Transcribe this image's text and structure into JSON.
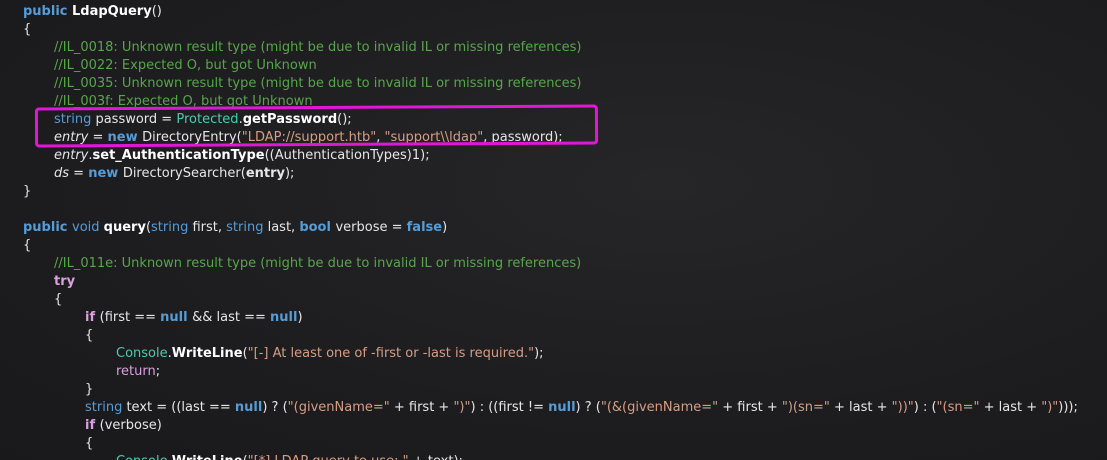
{
  "lines": [
    [
      {
        "t": "public ",
        "c": "kwb"
      },
      {
        "t": "LdapQuery",
        "c": "fn"
      },
      {
        "t": "()",
        "c": "pl"
      }
    ],
    [
      {
        "t": "{",
        "c": "pl"
      }
    ],
    [
      {
        "t": "//IL_0018: Unknown result type (might be due to invalid IL or missing references)",
        "c": "cm"
      }
    ],
    [
      {
        "t": "//IL_0022: Expected O, but got Unknown",
        "c": "cm"
      }
    ],
    [
      {
        "t": "//IL_0035: Unknown result type (might be due to invalid IL or missing references)",
        "c": "cm"
      }
    ],
    [
      {
        "t": "//IL_003f: Expected O, but got Unknown",
        "c": "cm"
      }
    ],
    [
      {
        "t": "string ",
        "c": "kw"
      },
      {
        "t": "password = ",
        "c": "pl"
      },
      {
        "t": "Protected",
        "c": "ty"
      },
      {
        "t": ".",
        "c": "pl"
      },
      {
        "t": "getPassword",
        "c": "fn"
      },
      {
        "t": "();",
        "c": "pl"
      }
    ],
    [
      {
        "t": "entry",
        "c": "var"
      },
      {
        "t": " = ",
        "c": "pl"
      },
      {
        "t": "new ",
        "c": "kwb"
      },
      {
        "t": "DirectoryEntry(",
        "c": "pl"
      },
      {
        "t": "\"LDAP://support.htb\"",
        "c": "str"
      },
      {
        "t": ", ",
        "c": "pl"
      },
      {
        "t": "\"support\\\\ldap\"",
        "c": "str"
      },
      {
        "t": ", password);",
        "c": "pl"
      }
    ],
    [
      {
        "t": "entry",
        "c": "var"
      },
      {
        "t": ".",
        "c": "pl"
      },
      {
        "t": "set_AuthenticationType",
        "c": "fn"
      },
      {
        "t": "((AuthenticationTypes)1);",
        "c": "pl"
      }
    ],
    [
      {
        "t": "ds",
        "c": "var"
      },
      {
        "t": " = ",
        "c": "pl"
      },
      {
        "t": "new ",
        "c": "kwb"
      },
      {
        "t": "DirectorySearcher(",
        "c": "pl"
      },
      {
        "t": "entry",
        "c": "bold"
      },
      {
        "t": ");",
        "c": "pl"
      }
    ],
    [
      {
        "t": "}",
        "c": "pl"
      }
    ],
    [],
    [
      {
        "t": "public ",
        "c": "kwb"
      },
      {
        "t": "void ",
        "c": "kw"
      },
      {
        "t": "query",
        "c": "fn"
      },
      {
        "t": "(",
        "c": "pl"
      },
      {
        "t": "string ",
        "c": "kw"
      },
      {
        "t": "first, ",
        "c": "pl"
      },
      {
        "t": "string ",
        "c": "kw"
      },
      {
        "t": "last, ",
        "c": "pl"
      },
      {
        "t": "bool ",
        "c": "kwb"
      },
      {
        "t": "verbose = ",
        "c": "pl"
      },
      {
        "t": "false",
        "c": "kwb"
      },
      {
        "t": ")",
        "c": "pl"
      }
    ],
    [
      {
        "t": "{",
        "c": "pl"
      }
    ],
    [
      {
        "t": "//IL_011e: Unknown result type (might be due to invalid IL or missing references)",
        "c": "cm"
      }
    ],
    [
      {
        "t": "try",
        "c": "ctl"
      }
    ],
    [
      {
        "t": "{",
        "c": "pl"
      }
    ],
    [
      {
        "t": "if ",
        "c": "ctl"
      },
      {
        "t": "(first == ",
        "c": "pl"
      },
      {
        "t": "null ",
        "c": "kwb"
      },
      {
        "t": "&& last == ",
        "c": "pl"
      },
      {
        "t": "null",
        "c": "kwb"
      },
      {
        "t": ")",
        "c": "pl"
      }
    ],
    [
      {
        "t": "{",
        "c": "pl"
      }
    ],
    [
      {
        "t": "Console",
        "c": "ty"
      },
      {
        "t": ".",
        "c": "pl"
      },
      {
        "t": "WriteLine",
        "c": "fn"
      },
      {
        "t": "(",
        "c": "pl"
      },
      {
        "t": "\"[-] At least one of -first or -last is required.\"",
        "c": "str"
      },
      {
        "t": ");",
        "c": "pl"
      }
    ],
    [
      {
        "t": "return",
        "c": "ctln"
      },
      {
        "t": ";",
        "c": "pl"
      }
    ],
    [
      {
        "t": "}",
        "c": "pl"
      }
    ],
    [
      {
        "t": "string ",
        "c": "kw"
      },
      {
        "t": "text = ((last == ",
        "c": "pl"
      },
      {
        "t": "null",
        "c": "kwb"
      },
      {
        "t": ") ? (",
        "c": "pl"
      },
      {
        "t": "\"(givenName=\"",
        "c": "str"
      },
      {
        "t": " + first + ",
        "c": "pl"
      },
      {
        "t": "\")\"",
        "c": "str"
      },
      {
        "t": ") : ((first != ",
        "c": "pl"
      },
      {
        "t": "null",
        "c": "kwb"
      },
      {
        "t": ") ? (",
        "c": "pl"
      },
      {
        "t": "\"(&(givenName=\"",
        "c": "str"
      },
      {
        "t": " + first + ",
        "c": "pl"
      },
      {
        "t": "\")(sn=\"",
        "c": "str"
      },
      {
        "t": " + last + ",
        "c": "pl"
      },
      {
        "t": "\"))\"",
        "c": "str"
      },
      {
        "t": ") : (",
        "c": "pl"
      },
      {
        "t": "\"(sn=\"",
        "c": "str"
      },
      {
        "t": " + last + ",
        "c": "pl"
      },
      {
        "t": "\")\"",
        "c": "str"
      },
      {
        "t": ")));",
        "c": "pl"
      }
    ],
    [
      {
        "t": "if ",
        "c": "ctl"
      },
      {
        "t": "(verbose)",
        "c": "pl"
      }
    ],
    [
      {
        "t": "{",
        "c": "pl"
      }
    ],
    [
      {
        "t": "Console",
        "c": "ty"
      },
      {
        "t": ".",
        "c": "pl"
      },
      {
        "t": "WriteLine",
        "c": "fn"
      },
      {
        "t": "(",
        "c": "pl"
      },
      {
        "t": "\"[*] LDAP query to use: \"",
        "c": "str"
      },
      {
        "t": " + text);",
        "c": "pl"
      }
    ]
  ]
}
